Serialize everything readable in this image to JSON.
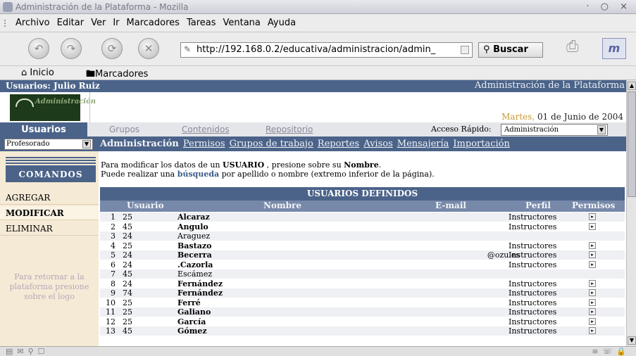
{
  "window": {
    "title": "Administración de la Plataforma - Mozilla"
  },
  "menu": [
    "Archivo",
    "Editar",
    "Ver",
    "Ir",
    "Marcadores",
    "Tareas",
    "Ventana",
    "Ayuda"
  ],
  "nav": {
    "url": "http://192.168.0.2/educativa/administracion/admin_",
    "search_label": "Buscar"
  },
  "bookmarks": {
    "home": "Inicio",
    "bookmarks": "Marcadores"
  },
  "page": {
    "user_label": "Usuarios: Julio Ruiz",
    "admin_title": "Administración de la Plataforma",
    "logo_text": "Administración",
    "date_day": "Martes,",
    "date_rest": " 01 de Junio de 2004",
    "tabs": {
      "active": "Usuarios",
      "grupos": "Grupos",
      "contenidos": "Contenidos",
      "repositorio": "Repositorio"
    },
    "acceso_label": "Acceso Rápido:",
    "acceso_value": "Administración",
    "profile_select": "Profesorado",
    "subnav": [
      "Administración",
      "Permisos",
      "Grupos de trabajo",
      "Reportes",
      "Avisos",
      "Mensajería",
      "Importación"
    ],
    "comandos": "COMANDOS",
    "commands": [
      "AGREGAR",
      "MODIFICAR",
      "ELIMINAR"
    ],
    "sidenote": "Para retornar a la plataforma presione sobre el logo",
    "intro1_pre": "Para modificar los datos de un ",
    "intro1_bold": "USUARIO",
    "intro1_mid": " , presione sobre su ",
    "intro1_bold2": "Nombre",
    "intro1_end": ".",
    "intro2_pre": "Puede realizar una ",
    "intro2_link": "búsqueda",
    "intro2_end": " por apellido o nombre (extremo inferior de la página).",
    "table_title": "USUARIOS DEFINIDOS",
    "columns": {
      "usuario": "Usuario",
      "nombre": "Nombre",
      "email": "E-mail",
      "perfil": "Perfil",
      "permisos": "Permisos"
    },
    "rows": [
      {
        "n": "1",
        "code": "25",
        "name": "Alcaraz",
        "email": "",
        "perfil": "Instructores"
      },
      {
        "n": "2",
        "code": "45",
        "name": "Angulo",
        "email": "",
        "perfil": "Instructores"
      },
      {
        "n": "3",
        "code": "24",
        "name": "Araguez",
        "email": "",
        "perfil": ""
      },
      {
        "n": "4",
        "code": "25",
        "name": "Bastazo",
        "email": "",
        "perfil": "Instructores"
      },
      {
        "n": "5",
        "code": "24",
        "name": "Becerra",
        "email": "@ozu.es",
        "perfil": "Instructores"
      },
      {
        "n": "6",
        "code": "24",
        "name": ".Cazorla",
        "email": "",
        "perfil": "Instructores"
      },
      {
        "n": "7",
        "code": "45",
        "name": "Escámez",
        "email": "",
        "perfil": ""
      },
      {
        "n": "8",
        "code": "24",
        "name": "Fernández",
        "email": "",
        "perfil": "Instructores"
      },
      {
        "n": "9",
        "code": "74",
        "name": "Fernández",
        "email": "",
        "perfil": "Instructores"
      },
      {
        "n": "10",
        "code": "25",
        "name": "Ferré",
        "email": "",
        "perfil": "Instructores"
      },
      {
        "n": "11",
        "code": "25",
        "name": "Galiano",
        "email": "",
        "perfil": "Instructores"
      },
      {
        "n": "12",
        "code": "25",
        "name": "García",
        "email": "",
        "perfil": "Instructores"
      },
      {
        "n": "13",
        "code": "45",
        "name": "Gómez",
        "email": "",
        "perfil": "Instructores"
      }
    ]
  },
  "colors": {
    "header_blue": "#4b6389",
    "sidebar_bg": "#f5ead6",
    "date_gold": "#c89a30"
  }
}
